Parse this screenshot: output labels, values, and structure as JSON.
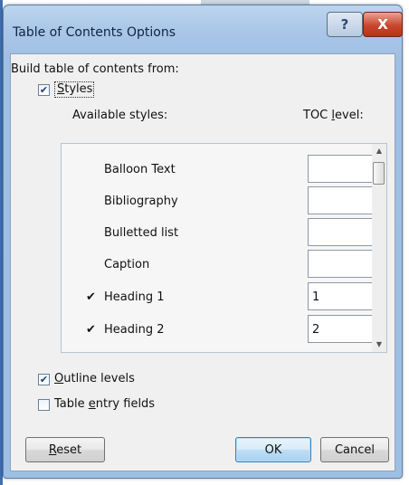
{
  "dialog": {
    "title": "Table of Contents Options",
    "help_symbol": "?",
    "close_symbol": "X"
  },
  "build_from_label": "Build table of contents from:",
  "styles": {
    "checked": true,
    "label_pre": "",
    "label_u": "S",
    "label_post": "tyles"
  },
  "columns": {
    "available": "Available styles:",
    "toc_pre": "TOC ",
    "toc_u": "l",
    "toc_post": "evel:"
  },
  "style_rows": [
    {
      "check": "",
      "name": "Balloon Text",
      "level": ""
    },
    {
      "check": "",
      "name": "Bibliography",
      "level": ""
    },
    {
      "check": "",
      "name": "Bulletted list",
      "level": ""
    },
    {
      "check": "",
      "name": "Caption",
      "level": ""
    },
    {
      "check": "✔",
      "name": "Heading 1",
      "level": "1"
    },
    {
      "check": "✔",
      "name": "Heading 2",
      "level": "2"
    }
  ],
  "scroll_up": "▲",
  "scroll_down": "▼",
  "outline_levels": {
    "checked": true,
    "label_u": "O",
    "label_post": "utline levels"
  },
  "table_entry": {
    "checked": false,
    "label_pre": "Table ",
    "label_u": "e",
    "label_post": "ntry fields"
  },
  "buttons": {
    "reset_u": "R",
    "reset_post": "eset",
    "ok": "OK",
    "cancel": "Cancel"
  },
  "colors": {
    "titlebar": "#a9c6e8",
    "close": "#c8472d",
    "client": "#f0f0f0"
  }
}
